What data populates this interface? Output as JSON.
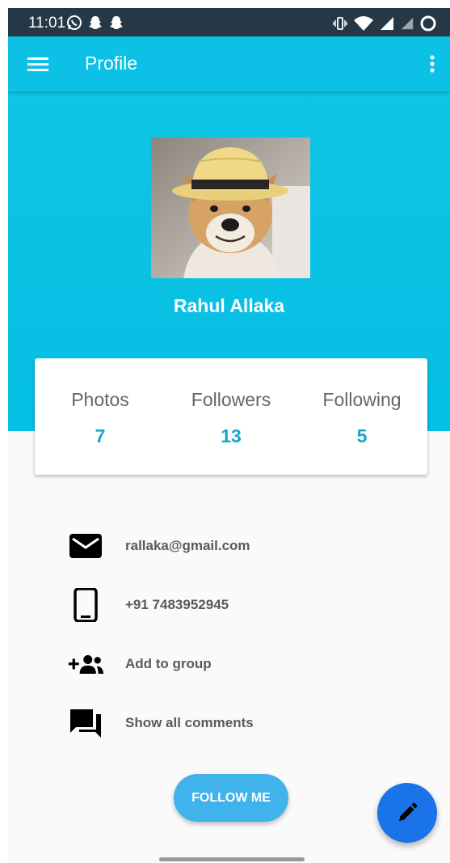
{
  "status_bar": {
    "time": "11:01",
    "left_icons": [
      "whatsapp-icon",
      "snapchat-icon",
      "snapchat-icon"
    ],
    "right_icons": [
      "vibrate-icon",
      "wifi-icon",
      "signal-icon",
      "signal-icon",
      "battery-icon"
    ]
  },
  "app_bar": {
    "title": "Profile",
    "menu_icon": "hamburger-menu-icon",
    "more_icon": "more-vertical-icon"
  },
  "profile": {
    "name": "Rahul Allaka"
  },
  "stats": [
    {
      "label": "Photos",
      "value": "7"
    },
    {
      "label": "Followers",
      "value": "13"
    },
    {
      "label": "Following",
      "value": "5"
    }
  ],
  "details": [
    {
      "icon": "email-icon",
      "text": "rallaka@gmail.com"
    },
    {
      "icon": "phone-icon",
      "text": "+91 7483952945"
    },
    {
      "icon": "add-group-icon",
      "text": "Add to group"
    },
    {
      "icon": "comments-icon",
      "text": "Show all comments"
    }
  ],
  "follow_button": {
    "label": "FOLLOW ME"
  },
  "fab": {
    "icon": "edit-pencil-icon"
  },
  "colors": {
    "status_bar": "#263746",
    "primary": "#0cc0e6",
    "stat_value": "#19a6c9",
    "follow_button": "#40b2ec",
    "fab": "#1a73e8"
  }
}
